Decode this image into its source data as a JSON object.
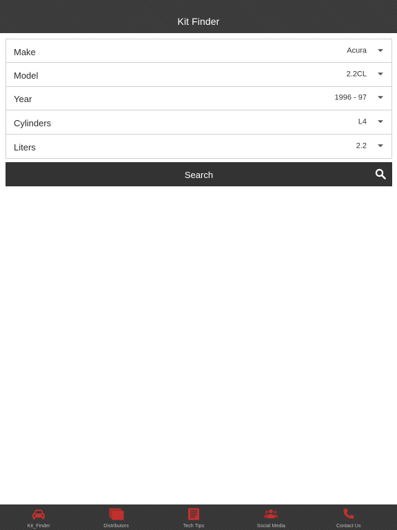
{
  "header": {
    "title": "Kit Finder"
  },
  "form": {
    "rows": [
      {
        "label": "Make",
        "value": "Acura"
      },
      {
        "label": "Model",
        "value": "2.2CL"
      },
      {
        "label": "Year",
        "value": "1996 - 97"
      },
      {
        "label": "Cylinders",
        "value": "L4"
      },
      {
        "label": "Liters",
        "value": "2.2"
      }
    ]
  },
  "search": {
    "label": "Search",
    "icon": "search-icon"
  },
  "tabbar": {
    "accent_color": "#c0312e",
    "tabs": [
      {
        "label": "Kit_Finder",
        "icon": "car-icon"
      },
      {
        "label": "Distributors",
        "icon": "stacked-pages-icon"
      },
      {
        "label": "Tech Tips",
        "icon": "document-icon"
      },
      {
        "label": "Social Media",
        "icon": "people-icon"
      },
      {
        "label": "Contact Us",
        "icon": "phone-icon"
      }
    ]
  }
}
